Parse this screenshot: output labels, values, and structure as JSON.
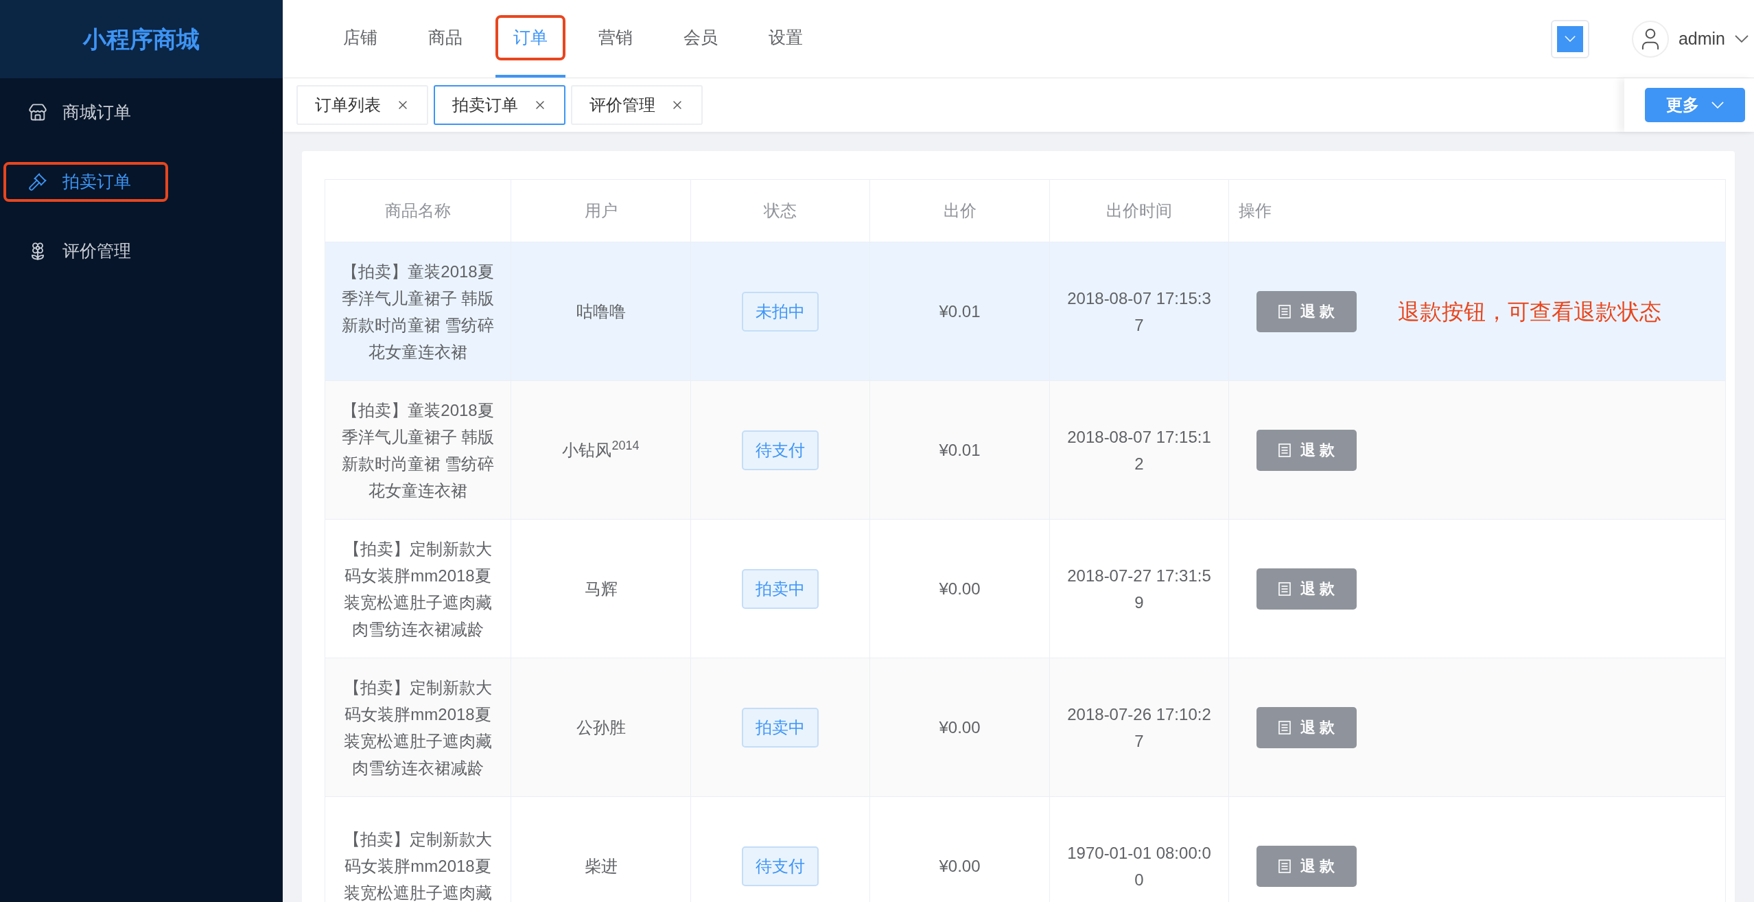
{
  "sidebar": {
    "logo": "小程序商城",
    "items": [
      {
        "label": "商城订单",
        "selected": false,
        "highlighted": false
      },
      {
        "label": "拍卖订单",
        "selected": true,
        "highlighted": true
      },
      {
        "label": "评价管理",
        "selected": false,
        "highlighted": false
      }
    ]
  },
  "nav": {
    "items": [
      {
        "label": "店铺",
        "selected": false,
        "highlighted": false
      },
      {
        "label": "商品",
        "selected": false,
        "highlighted": false
      },
      {
        "label": "订单",
        "selected": true,
        "highlighted": true
      },
      {
        "label": "营销",
        "selected": false,
        "highlighted": false
      },
      {
        "label": "会员",
        "selected": false,
        "highlighted": false
      },
      {
        "label": "设置",
        "selected": false,
        "highlighted": false
      }
    ],
    "user": "admin"
  },
  "tabs": {
    "items": [
      {
        "label": "订单列表",
        "selected": false
      },
      {
        "label": "拍卖订单",
        "selected": true
      },
      {
        "label": "评价管理",
        "selected": false
      }
    ],
    "more": "更多"
  },
  "table": {
    "columns": [
      "商品名称",
      "用户",
      "状态",
      "出价",
      "出价时间",
      "操作"
    ],
    "rows": [
      {
        "product": "【拍卖】童装2018夏季洋气儿童裙子 韩版新款时尚童裙 雪纺碎花女童连衣裙",
        "user": "咕噜噜",
        "status": "未拍中",
        "price": "¥0.01",
        "time": "2018-08-07 17:15:3\n7",
        "action": "退 款",
        "note": "退款按钮，可查看退款状态",
        "selected": true
      },
      {
        "product": "【拍卖】童装2018夏季洋气儿童裙子 韩版新款时尚童裙 雪纺碎花女童连衣裙",
        "user": "小钻风$^{2014}$",
        "status": "待支付",
        "price": "¥0.01",
        "time": "2018-08-07 17:15:1\n2",
        "action": "退 款",
        "selected": false
      },
      {
        "product": "【拍卖】定制新款大码女装胖mm2018夏装宽松遮肚子遮肉藏肉雪纺连衣裙减龄",
        "user": "马辉",
        "status": "拍卖中",
        "price": "¥0.00",
        "time": "2018-07-27 17:31:5\n9",
        "action": "退 款",
        "selected": false
      },
      {
        "product": "【拍卖】定制新款大码女装胖mm2018夏装宽松遮肚子遮肉藏肉雪纺连衣裙减龄",
        "user": "公孙胜",
        "status": "拍卖中",
        "price": "¥0.00",
        "time": "2018-07-26 17:10:2\n7",
        "action": "退 款",
        "selected": false
      },
      {
        "product": "【拍卖】定制新款大码女装胖mm2018夏装宽松遮肚子遮肉藏",
        "user": "柴进",
        "status": "待支付",
        "price": "¥0.00",
        "time": "1970-01-01 08:00:0\n0",
        "action": "退 款",
        "selected": false
      }
    ]
  }
}
